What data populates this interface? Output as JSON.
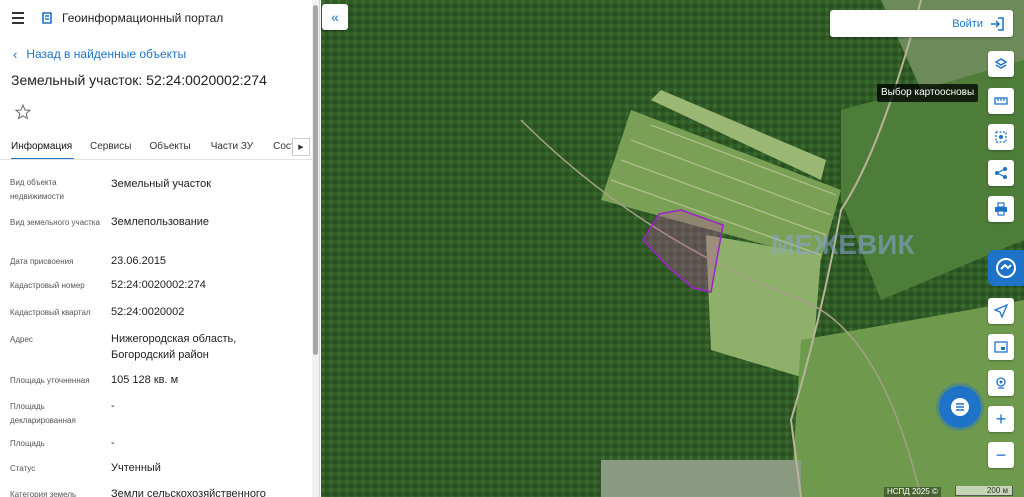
{
  "header": {
    "portal_title": "Геоинформационный портал"
  },
  "back_link": "Назад в найденные объекты",
  "object_title": "Земельный участок: 52:24:0020002:274",
  "tabs": [
    {
      "label": "Информация",
      "active": true
    },
    {
      "label": "Сервисы"
    },
    {
      "label": "Объекты"
    },
    {
      "label": "Части ЗУ"
    },
    {
      "label": "Соста"
    }
  ],
  "properties": [
    {
      "key": "Вид объекта недвижимости",
      "value": "Земельный участок"
    },
    {
      "key": "Вид земельного участка",
      "value": "Землепользование"
    },
    {
      "key": "Дата присвоения",
      "value": "23.06.2015"
    },
    {
      "key": "Кадастровый номер",
      "value": "52:24:0020002:274"
    },
    {
      "key": "Кадастровый квартал",
      "value": "52:24:0020002"
    },
    {
      "key": "Адрес",
      "value": "Нижегородская область, Богородский район"
    },
    {
      "key": "Площадь уточненная",
      "value": "105 128 кв. м"
    },
    {
      "key": "Площадь декларированная",
      "value": "-"
    },
    {
      "key": "Площадь",
      "value": "-"
    },
    {
      "key": "Статус",
      "value": "Учтенный"
    },
    {
      "key": "Категория земель",
      "value": "Земли сельскохозяйственного"
    }
  ],
  "map": {
    "login_label": "Войти",
    "basemap_tooltip": "Выбор картоосновы",
    "copyright": "НСПД 2025 ©",
    "scale_label": "200 м",
    "watermark": "МЕЖЕВИК"
  },
  "colors": {
    "accent": "#1e73c8",
    "parcel_outline": "#a020d0"
  }
}
